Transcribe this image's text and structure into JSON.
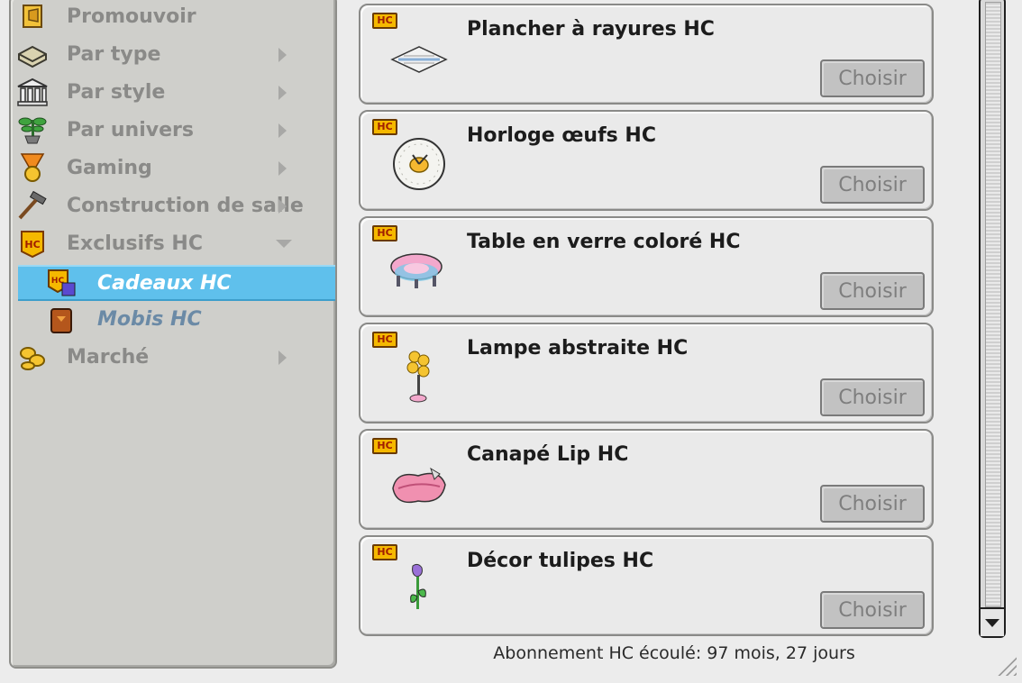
{
  "sidebar": {
    "items": [
      {
        "label": "Promouvoir",
        "icon": "megaphone-icon"
      },
      {
        "label": "Par type",
        "icon": "sofa-icon"
      },
      {
        "label": "Par style",
        "icon": "columns-icon"
      },
      {
        "label": "Par univers",
        "icon": "plant-icon"
      },
      {
        "label": "Gaming",
        "icon": "medal-icon"
      },
      {
        "label": "Construction de salle",
        "icon": "hammer-icon"
      },
      {
        "label": "Exclusifs HC",
        "icon": "hc-badge-icon"
      },
      {
        "label": "Marché",
        "icon": "coins-icon"
      }
    ],
    "subitems": [
      {
        "label": "Cadeaux HC",
        "icon": "hc-gift-icon",
        "active": true
      },
      {
        "label": "Mobis HC",
        "icon": "hc-bag-icon",
        "active": false
      }
    ]
  },
  "products": [
    {
      "name": "Plancher à rayures HC",
      "button": "Choisir",
      "badge": "HC",
      "icon": "striped-floor-icon"
    },
    {
      "name": "Horloge œufs HC",
      "button": "Choisir",
      "badge": "HC",
      "icon": "egg-clock-icon"
    },
    {
      "name": "Table en verre coloré HC",
      "button": "Choisir",
      "badge": "HC",
      "icon": "glass-table-icon"
    },
    {
      "name": "Lampe abstraite HC",
      "button": "Choisir",
      "badge": "HC",
      "icon": "abstract-lamp-icon"
    },
    {
      "name": "Canapé Lip HC",
      "button": "Choisir",
      "badge": "HC",
      "icon": "lip-sofa-icon"
    },
    {
      "name": "Décor tulipes HC",
      "button": "Choisir",
      "badge": "HC",
      "icon": "tulip-icon"
    }
  ],
  "footer": {
    "subscription_text": "Abonnement HC écoulé: 97 mois, 27 jours"
  },
  "colors": {
    "active_highlight": "#5fc0ec",
    "hc_badge": "#f5b800"
  }
}
